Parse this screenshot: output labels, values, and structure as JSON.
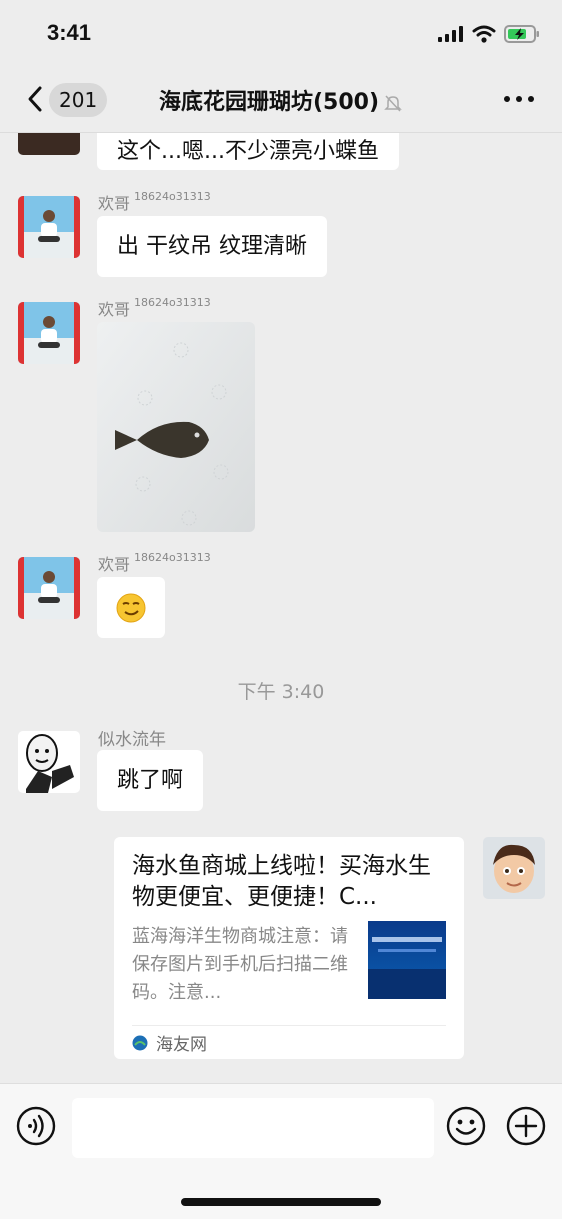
{
  "status": {
    "time": "3:41"
  },
  "nav": {
    "back_count": "201",
    "title": "海底花园珊瑚坊(500)"
  },
  "messages": [
    {
      "text": "这个...嗯...不少漂亮小蝶鱼"
    },
    {
      "sender": "欢哥",
      "sender_num": "18624o31313",
      "text": "出 干纹吊 纹理清晰"
    },
    {
      "sender": "欢哥",
      "sender_num": "18624o31313",
      "image": "fish-photo"
    },
    {
      "sender": "欢哥",
      "sender_num": "18624o31313",
      "emoji": "smirk-emoji"
    },
    {
      "sender": "似水流年",
      "text": "跳了啊"
    }
  ],
  "timestamp": "下午 3:40",
  "link_card": {
    "title": "海水鱼商城上线啦！买海水生物更便宜、更便捷！C...",
    "description": "蓝海海洋生物商城注意：请保存图片到手机后扫描二维码。注意...",
    "source": "海友网"
  },
  "input_bar": {
    "placeholder": ""
  },
  "colors": {
    "background": "#ededed",
    "bubble": "#ffffff",
    "meta": "#888888"
  }
}
